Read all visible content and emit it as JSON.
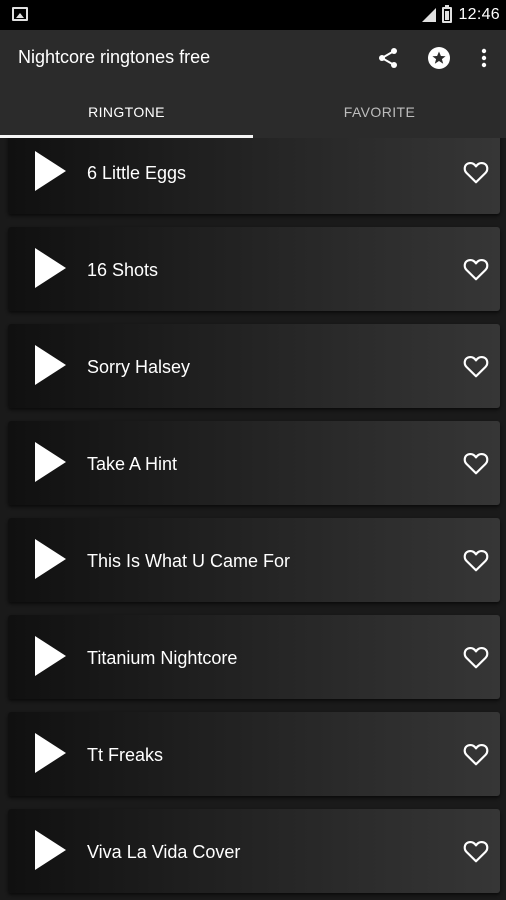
{
  "status_bar": {
    "time": "12:46",
    "icons": [
      "image-icon",
      "signal-icon",
      "battery-icon"
    ]
  },
  "toolbar": {
    "title": "Nightcore ringtones free",
    "actions": [
      {
        "name": "share-icon"
      },
      {
        "name": "star-icon"
      },
      {
        "name": "more-vertical-icon"
      }
    ]
  },
  "tabs": [
    {
      "label": "RINGTONE",
      "selected": true
    },
    {
      "label": "FAVORITE",
      "selected": false
    }
  ],
  "ringtones": [
    {
      "title": "6 Little Eggs"
    },
    {
      "title": "16 Shots"
    },
    {
      "title": "Sorry Halsey"
    },
    {
      "title": "Take A Hint"
    },
    {
      "title": "This Is What U Came For"
    },
    {
      "title": "Titanium Nightcore"
    },
    {
      "title": "Tt Freaks"
    },
    {
      "title": "Viva La Vida Cover"
    }
  ],
  "colors": {
    "toolbar": "#2b2b2b",
    "status_bar": "#000000",
    "accent": "#f5f5f5"
  }
}
